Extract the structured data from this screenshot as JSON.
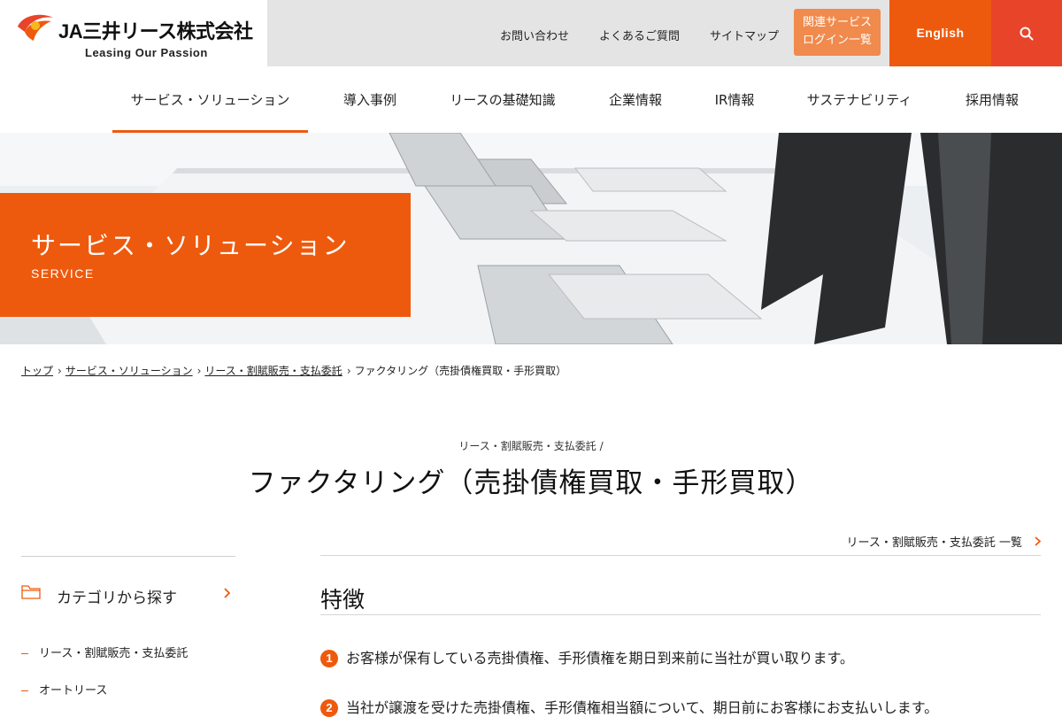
{
  "header": {
    "company_name": "JA三井リース株式会社",
    "tagline": "Leasing Our Passion",
    "utility_links": [
      "お問い合わせ",
      "よくあるご質問",
      "サイトマップ"
    ],
    "login_button": [
      "関連サービス",
      "ログイン一覧"
    ],
    "english_label": "English",
    "search_icon": "search-icon",
    "brand_color": "#ee5a0d"
  },
  "nav": {
    "items": [
      "サービス・ソリューション",
      "導入事例",
      "リースの基礎知識",
      "企業情報",
      "IR情報",
      "サステナビリティ",
      "採用情報"
    ],
    "active_index": 0
  },
  "hero": {
    "title": "サービス・ソリューション",
    "subtitle": "SERVICE"
  },
  "breadcrumb": {
    "items": [
      "トップ",
      "サービス・ソリューション",
      "リース・割賦販売・支払委託"
    ],
    "current": "ファクタリング（売掛債権買取・手形買取）"
  },
  "page": {
    "category_label": "リース・割賦販売・支払委託 /",
    "title": "ファクタリング（売掛債権買取・手形買取）",
    "list_link": "リース・割賦販売・支払委託 一覧"
  },
  "sidebar": {
    "heading": "カテゴリから探す",
    "items": [
      "リース・割賦販売・支払委託",
      "オートリース"
    ]
  },
  "content": {
    "section_title": "特徴",
    "features": [
      {
        "num": "1",
        "text": "お客様が保有している売掛債権、手形債権を期日到来前に当社が買い取ります。"
      },
      {
        "num": "2",
        "text": "当社が譲渡を受けた売掛債権、手形債権相当額について、期日前にお客様にお支払いします。"
      }
    ]
  }
}
